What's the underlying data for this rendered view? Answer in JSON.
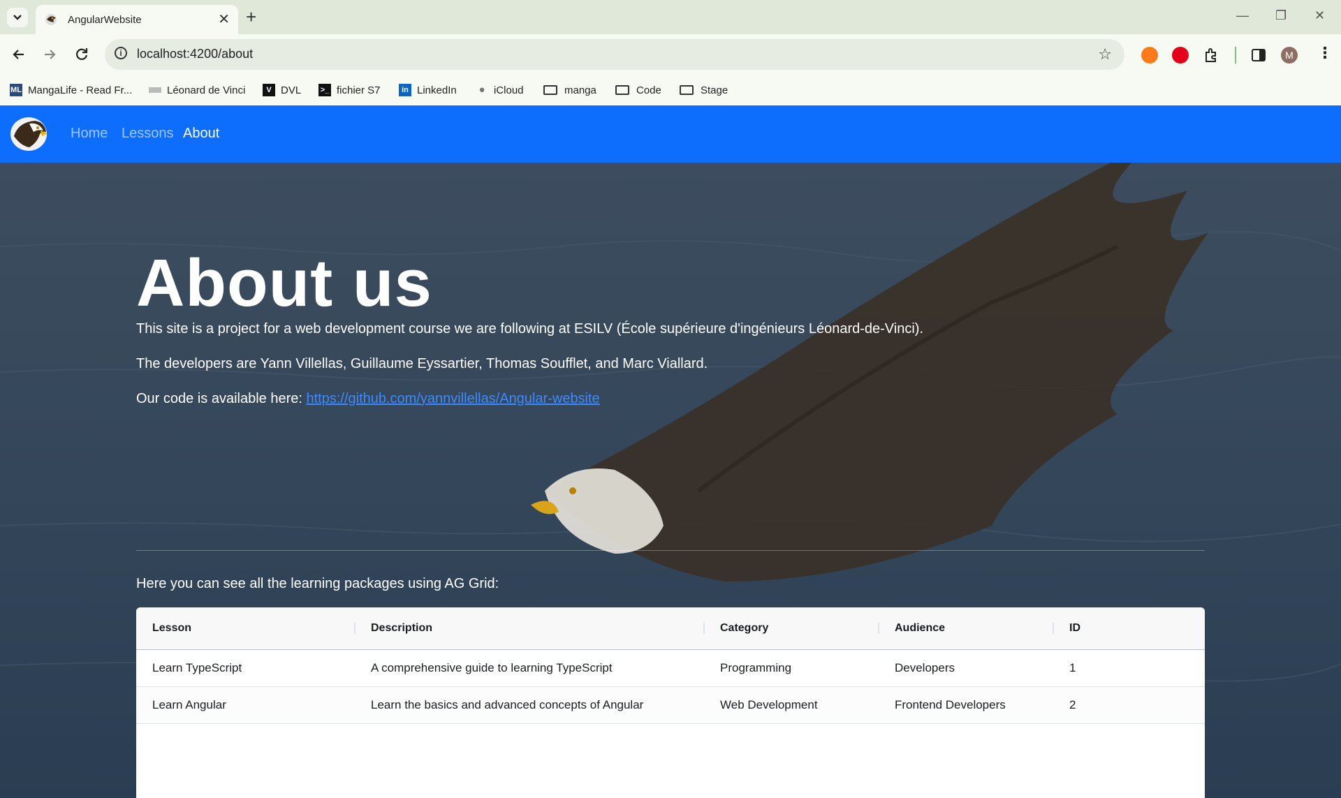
{
  "browser": {
    "tab_title": "AngularWebsite",
    "url": "localhost:4200/about",
    "profile_initial": "M",
    "bookmarks": [
      {
        "label": "MangaLife - Read Fr...",
        "icon": "mangalife-icon"
      },
      {
        "label": "Léonard de Vinci",
        "icon": "ldv-icon"
      },
      {
        "label": "DVL",
        "icon": "dvl-icon"
      },
      {
        "label": "fichier S7",
        "icon": "terminal-icon"
      },
      {
        "label": "LinkedIn",
        "icon": "linkedin-icon"
      },
      {
        "label": "iCloud",
        "icon": "apple-icon"
      },
      {
        "label": "manga",
        "icon": "folder-icon"
      },
      {
        "label": "Code",
        "icon": "folder-icon"
      },
      {
        "label": "Stage",
        "icon": "folder-icon"
      }
    ]
  },
  "navbar": {
    "links": [
      "Home",
      "Lessons",
      "About"
    ],
    "active": "About",
    "color": "#0d6efd"
  },
  "about": {
    "title": "About us",
    "p1": "This site is a project for a web development course we are following at ESILV (École supérieure d'ingénieurs Léonard-de-Vinci).",
    "p2": "The developers are Yann Villellas, Guillaume Eyssartier, Thomas Soufflet, and Marc Viallard.",
    "p3_prefix": "Our code is available here: ",
    "p3_link": "https://github.com/yannvillellas/Angular-website",
    "grid_intro": "Here you can see all the learning packages using AG Grid:"
  },
  "grid": {
    "columns": [
      "Lesson",
      "Description",
      "Category",
      "Audience",
      "ID"
    ],
    "rows": [
      [
        "Learn TypeScript",
        "A comprehensive guide to learning TypeScript",
        "Programming",
        "Developers",
        "1"
      ],
      [
        "Learn Angular",
        "Learn the basics and advanced concepts of Angular",
        "Web Development",
        "Frontend Developers",
        "2"
      ]
    ]
  }
}
